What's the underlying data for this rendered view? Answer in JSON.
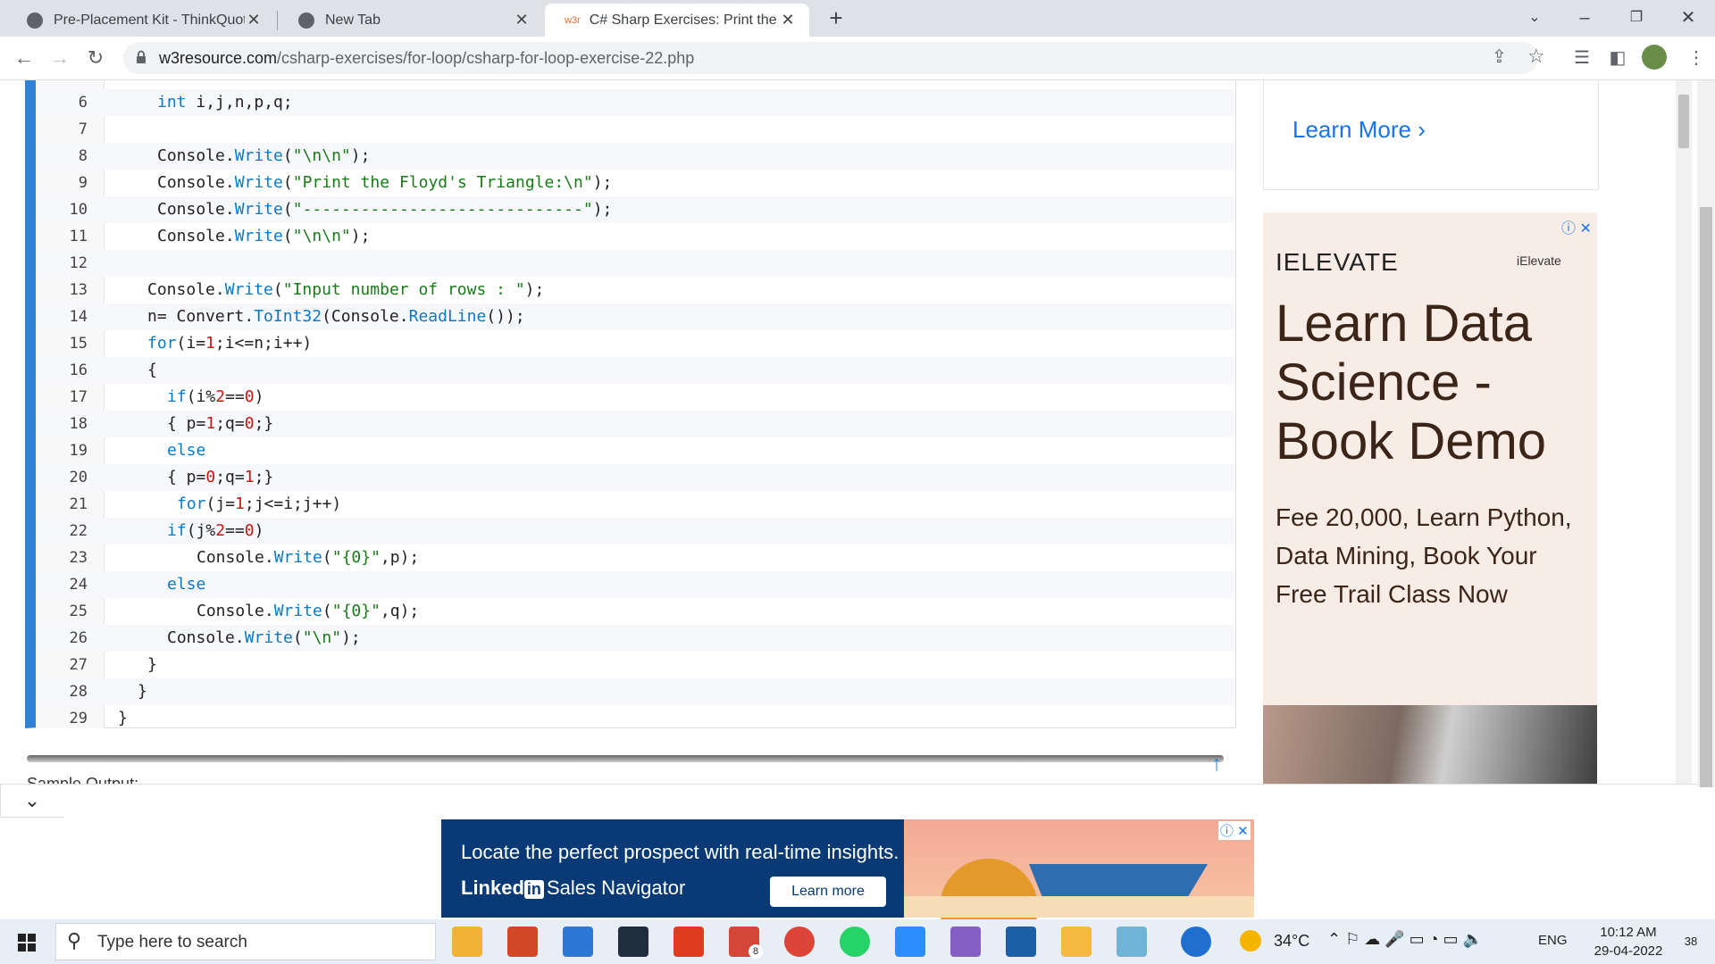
{
  "browser": {
    "tabs": [
      {
        "title": "Pre-Placement Kit - ThinkQuotier",
        "active": false
      },
      {
        "title": "New Tab",
        "active": false
      },
      {
        "title": "C# Sharp Exercises: Print the Floy",
        "active": true,
        "favicon_text": "w3r"
      }
    ],
    "url_domain": "w3resource.com",
    "url_path": "/csharp-exercises/for-loop/csharp-for-loop-exercise-22.php"
  },
  "code": {
    "lines": [
      {
        "n": "6",
        "text": "int i,j,n,p,q;"
      },
      {
        "n": "7",
        "text": ""
      },
      {
        "n": "8",
        "text": "Console.Write(\"\\n\\n\");"
      },
      {
        "n": "9",
        "text": "Console.Write(\"Print the Floyd's Triangle:\\n\");"
      },
      {
        "n": "10",
        "text": "Console.Write(\"-----------------------------\");"
      },
      {
        "n": "11",
        "text": "Console.Write(\"\\n\\n\");"
      },
      {
        "n": "12",
        "text": ""
      },
      {
        "n": "13",
        "text": "Console.Write(\"Input number of rows : \");"
      },
      {
        "n": "14",
        "text": "n= Convert.ToInt32(Console.ReadLine());"
      },
      {
        "n": "15",
        "text": "for(i=1;i<=n;i++)"
      },
      {
        "n": "16",
        "text": "{"
      },
      {
        "n": "17",
        "text": "if(i%2==0)"
      },
      {
        "n": "18",
        "text": "{ p=1;q=0;}"
      },
      {
        "n": "19",
        "text": "else"
      },
      {
        "n": "20",
        "text": "{ p=0;q=1;}"
      },
      {
        "n": "21",
        "text": "for(j=1;j<=i;j++)"
      },
      {
        "n": "22",
        "text": "if(j%2==0)"
      },
      {
        "n": "23",
        "text": "Console.Write(\"{0}\",p);"
      },
      {
        "n": "24",
        "text": "else"
      },
      {
        "n": "25",
        "text": "Console.Write(\"{0}\",q);"
      },
      {
        "n": "26",
        "text": "Console.Write(\"\\n\");"
      },
      {
        "n": "27",
        "text": "}"
      },
      {
        "n": "28",
        "text": "}"
      },
      {
        "n": "29",
        "text": "}"
      }
    ]
  },
  "sample_output_label": "Sample Output:",
  "sidebar": {
    "learn_more": "Learn More",
    "ad": {
      "brand": "IELEVATE",
      "brand_small": "iElevate",
      "headline": "Learn Data Science - Book Demo",
      "body": "Fee 20,000, Learn Python, Data Mining, Book Your Free Trail Class Now"
    }
  },
  "bottom_ad": {
    "headline": "Locate the perfect prospect with real-time insights.",
    "logo_text": "Linked",
    "logo_in": "in",
    "product": "Sales Navigator",
    "button": "Learn more"
  },
  "taskbar": {
    "search_placeholder": "Type here to search",
    "mail_badge": "8",
    "temperature": "34°C",
    "language": "ENG",
    "time": "10:12 AM",
    "date": "29-04-2022",
    "notifications": "38"
  },
  "colors": {
    "accent": "#2f82d8",
    "link": "#1a73e8",
    "keyword": "#0b7ac6",
    "string": "#1a7a1a",
    "number": "#c41a16"
  }
}
